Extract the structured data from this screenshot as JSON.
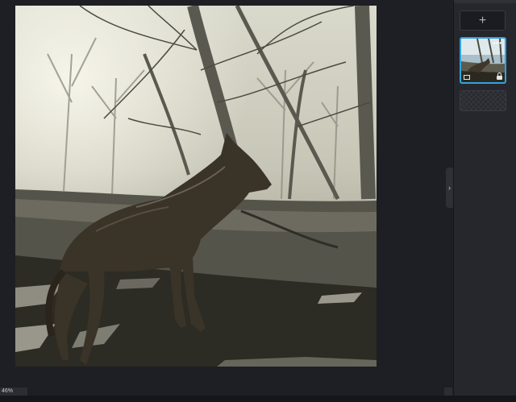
{
  "canvas": {
    "image_subject": "wolf-on-fallen-log-in-misty-forest",
    "zoom_label": "46%"
  },
  "layers_panel": {
    "add_button_label": "+",
    "collapse_label": "›",
    "layer_menu_label": "•••",
    "selected_accent": "#2fa3e0"
  }
}
